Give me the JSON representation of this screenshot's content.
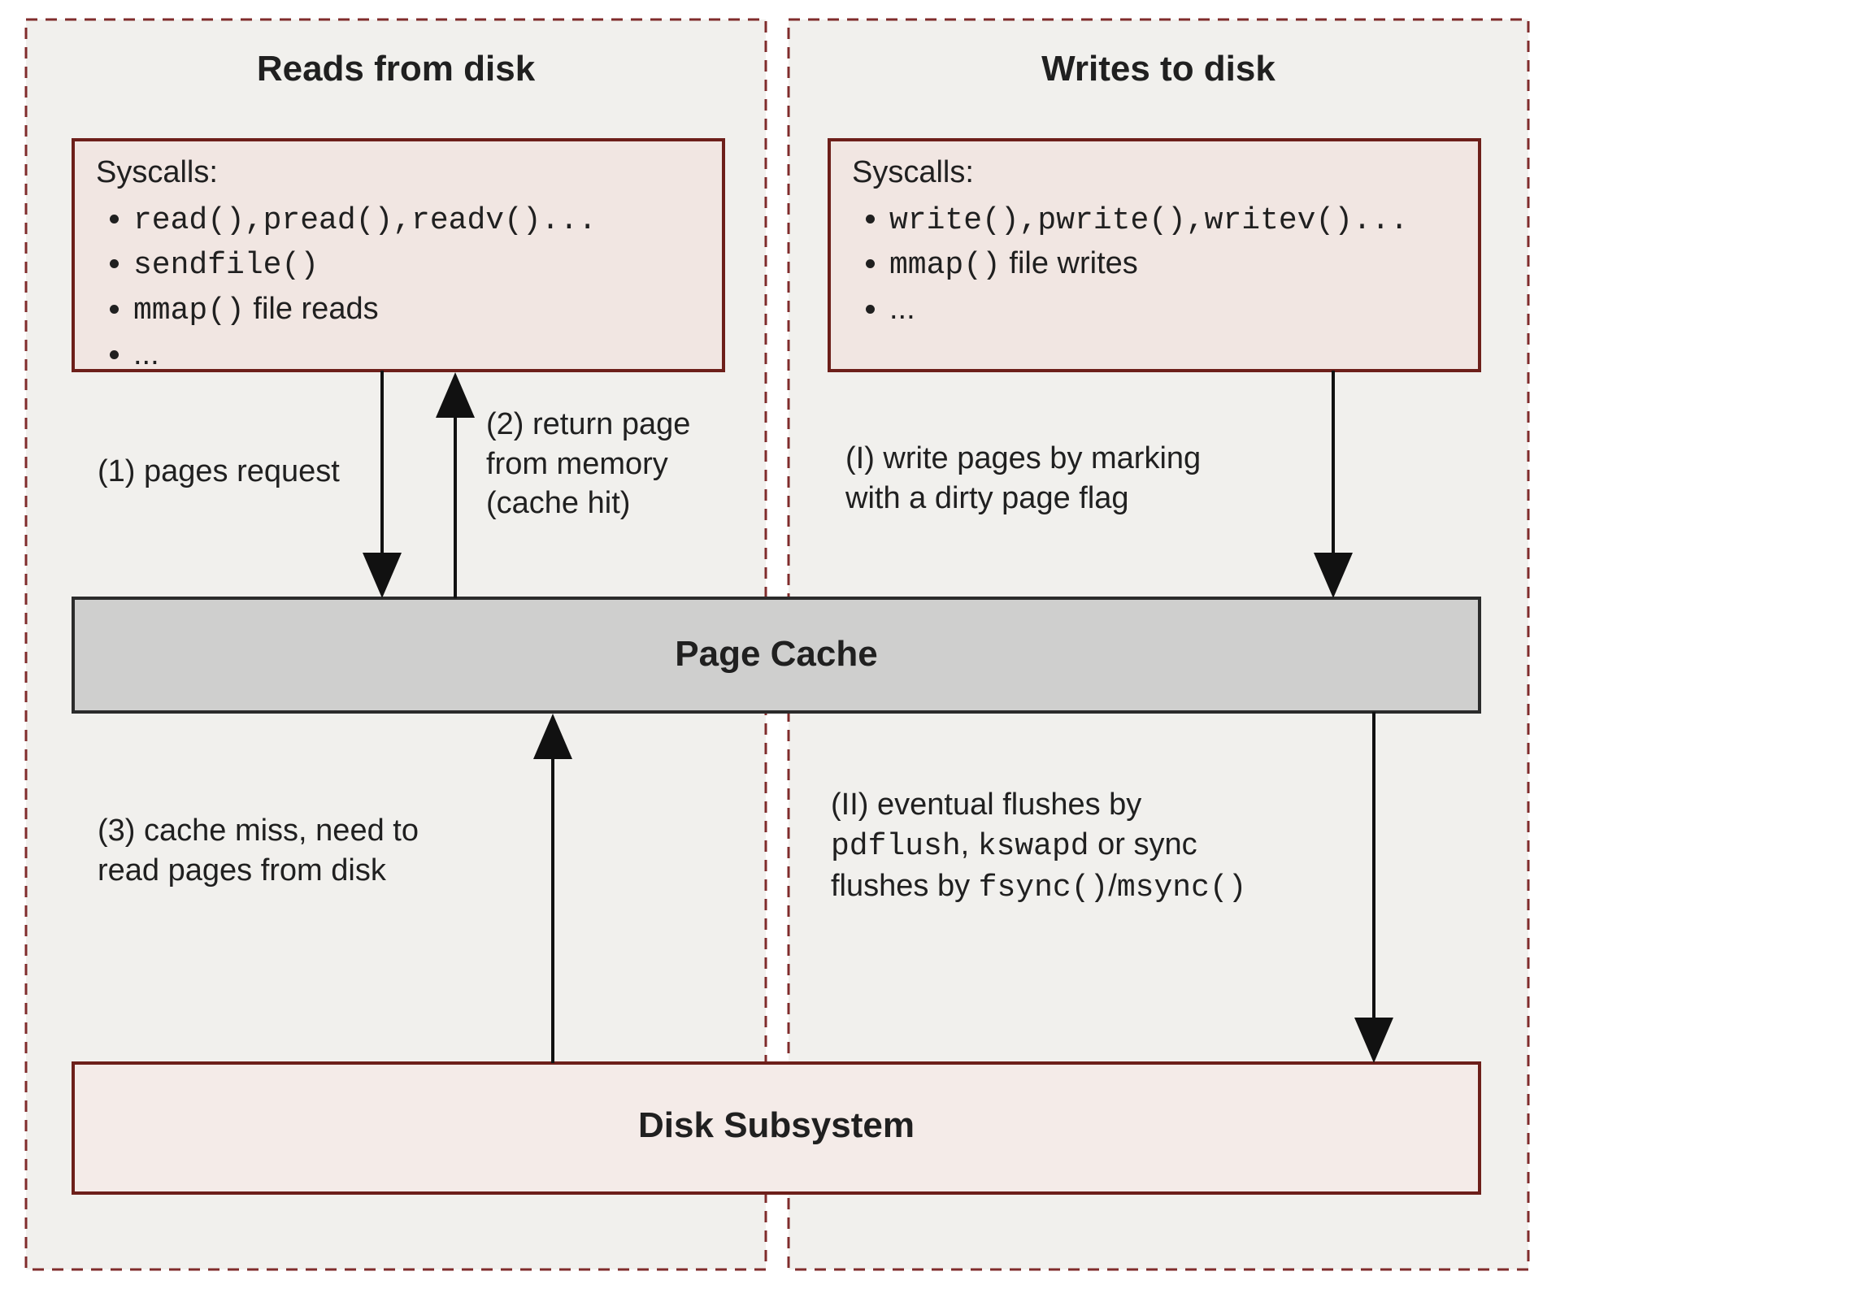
{
  "reads": {
    "title": "Reads from disk",
    "syscall_heading": "Syscalls:",
    "syscall_1_pre": "read(),pread(),readv()...",
    "syscall_2_pre": "sendfile()",
    "syscall_3_pre": "mmap()",
    "syscall_3_post": "file reads",
    "syscall_4": "...",
    "step1": "(1) pages request",
    "step2_l1": "(2) return page",
    "step2_l2": "from memory",
    "step2_l3": "(cache hit)",
    "step3_l1": "(3) cache miss, need to",
    "step3_l2": "read pages from disk"
  },
  "writes": {
    "title": "Writes to disk",
    "syscall_heading": "Syscalls:",
    "syscall_1_pre": "write(),pwrite(),writev()...",
    "syscall_2_pre": "mmap()",
    "syscall_2_post": "file writes",
    "syscall_3": "...",
    "stepI_l1": "(I) write pages by marking",
    "stepI_l2": "with a dirty page flag",
    "stepII_l1_pre": "(II) eventual flushes by",
    "stepII_l2_m1": "pdflush",
    "stepII_l2_mid": ", ",
    "stepII_l2_m2": "kswapd",
    "stepII_l2_post": " or sync",
    "stepII_l3_pre": "flushes by ",
    "stepII_l3_m1": "fsync()",
    "stepII_l3_sep": "/",
    "stepII_l3_m2": "msync()"
  },
  "pagecache_label": "Page Cache",
  "disksubsystem_label": "Disk Subsystem",
  "colors": {
    "panel_fill": "#f1f0ed",
    "panel_stroke": "#802c2c",
    "syscall_fill": "#f1e6e2",
    "syscall_stroke": "#6d1f1a",
    "pagecache_fill": "#cfcfce",
    "disk_fill": "#f4ebe8"
  }
}
